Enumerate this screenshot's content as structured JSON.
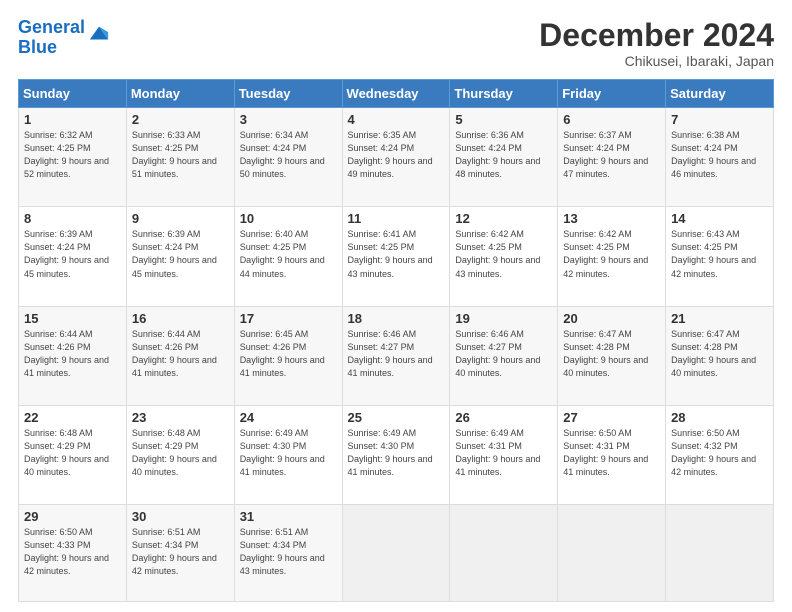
{
  "header": {
    "logo_line1": "General",
    "logo_line2": "Blue",
    "title": "December 2024",
    "subtitle": "Chikusei, Ibaraki, Japan"
  },
  "weekdays": [
    "Sunday",
    "Monday",
    "Tuesday",
    "Wednesday",
    "Thursday",
    "Friday",
    "Saturday"
  ],
  "weeks": [
    [
      {
        "day": "1",
        "sunrise": "6:32 AM",
        "sunset": "4:25 PM",
        "daylight": "9 hours and 52 minutes."
      },
      {
        "day": "2",
        "sunrise": "6:33 AM",
        "sunset": "4:25 PM",
        "daylight": "9 hours and 51 minutes."
      },
      {
        "day": "3",
        "sunrise": "6:34 AM",
        "sunset": "4:24 PM",
        "daylight": "9 hours and 50 minutes."
      },
      {
        "day": "4",
        "sunrise": "6:35 AM",
        "sunset": "4:24 PM",
        "daylight": "9 hours and 49 minutes."
      },
      {
        "day": "5",
        "sunrise": "6:36 AM",
        "sunset": "4:24 PM",
        "daylight": "9 hours and 48 minutes."
      },
      {
        "day": "6",
        "sunrise": "6:37 AM",
        "sunset": "4:24 PM",
        "daylight": "9 hours and 47 minutes."
      },
      {
        "day": "7",
        "sunrise": "6:38 AM",
        "sunset": "4:24 PM",
        "daylight": "9 hours and 46 minutes."
      }
    ],
    [
      {
        "day": "8",
        "sunrise": "6:39 AM",
        "sunset": "4:24 PM",
        "daylight": "9 hours and 45 minutes."
      },
      {
        "day": "9",
        "sunrise": "6:39 AM",
        "sunset": "4:24 PM",
        "daylight": "9 hours and 45 minutes."
      },
      {
        "day": "10",
        "sunrise": "6:40 AM",
        "sunset": "4:25 PM",
        "daylight": "9 hours and 44 minutes."
      },
      {
        "day": "11",
        "sunrise": "6:41 AM",
        "sunset": "4:25 PM",
        "daylight": "9 hours and 43 minutes."
      },
      {
        "day": "12",
        "sunrise": "6:42 AM",
        "sunset": "4:25 PM",
        "daylight": "9 hours and 43 minutes."
      },
      {
        "day": "13",
        "sunrise": "6:42 AM",
        "sunset": "4:25 PM",
        "daylight": "9 hours and 42 minutes."
      },
      {
        "day": "14",
        "sunrise": "6:43 AM",
        "sunset": "4:25 PM",
        "daylight": "9 hours and 42 minutes."
      }
    ],
    [
      {
        "day": "15",
        "sunrise": "6:44 AM",
        "sunset": "4:26 PM",
        "daylight": "9 hours and 41 minutes."
      },
      {
        "day": "16",
        "sunrise": "6:44 AM",
        "sunset": "4:26 PM",
        "daylight": "9 hours and 41 minutes."
      },
      {
        "day": "17",
        "sunrise": "6:45 AM",
        "sunset": "4:26 PM",
        "daylight": "9 hours and 41 minutes."
      },
      {
        "day": "18",
        "sunrise": "6:46 AM",
        "sunset": "4:27 PM",
        "daylight": "9 hours and 41 minutes."
      },
      {
        "day": "19",
        "sunrise": "6:46 AM",
        "sunset": "4:27 PM",
        "daylight": "9 hours and 40 minutes."
      },
      {
        "day": "20",
        "sunrise": "6:47 AM",
        "sunset": "4:28 PM",
        "daylight": "9 hours and 40 minutes."
      },
      {
        "day": "21",
        "sunrise": "6:47 AM",
        "sunset": "4:28 PM",
        "daylight": "9 hours and 40 minutes."
      }
    ],
    [
      {
        "day": "22",
        "sunrise": "6:48 AM",
        "sunset": "4:29 PM",
        "daylight": "9 hours and 40 minutes."
      },
      {
        "day": "23",
        "sunrise": "6:48 AM",
        "sunset": "4:29 PM",
        "daylight": "9 hours and 40 minutes."
      },
      {
        "day": "24",
        "sunrise": "6:49 AM",
        "sunset": "4:30 PM",
        "daylight": "9 hours and 41 minutes."
      },
      {
        "day": "25",
        "sunrise": "6:49 AM",
        "sunset": "4:30 PM",
        "daylight": "9 hours and 41 minutes."
      },
      {
        "day": "26",
        "sunrise": "6:49 AM",
        "sunset": "4:31 PM",
        "daylight": "9 hours and 41 minutes."
      },
      {
        "day": "27",
        "sunrise": "6:50 AM",
        "sunset": "4:31 PM",
        "daylight": "9 hours and 41 minutes."
      },
      {
        "day": "28",
        "sunrise": "6:50 AM",
        "sunset": "4:32 PM",
        "daylight": "9 hours and 42 minutes."
      }
    ],
    [
      {
        "day": "29",
        "sunrise": "6:50 AM",
        "sunset": "4:33 PM",
        "daylight": "9 hours and 42 minutes."
      },
      {
        "day": "30",
        "sunrise": "6:51 AM",
        "sunset": "4:34 PM",
        "daylight": "9 hours and 42 minutes."
      },
      {
        "day": "31",
        "sunrise": "6:51 AM",
        "sunset": "4:34 PM",
        "daylight": "9 hours and 43 minutes."
      },
      null,
      null,
      null,
      null
    ]
  ]
}
